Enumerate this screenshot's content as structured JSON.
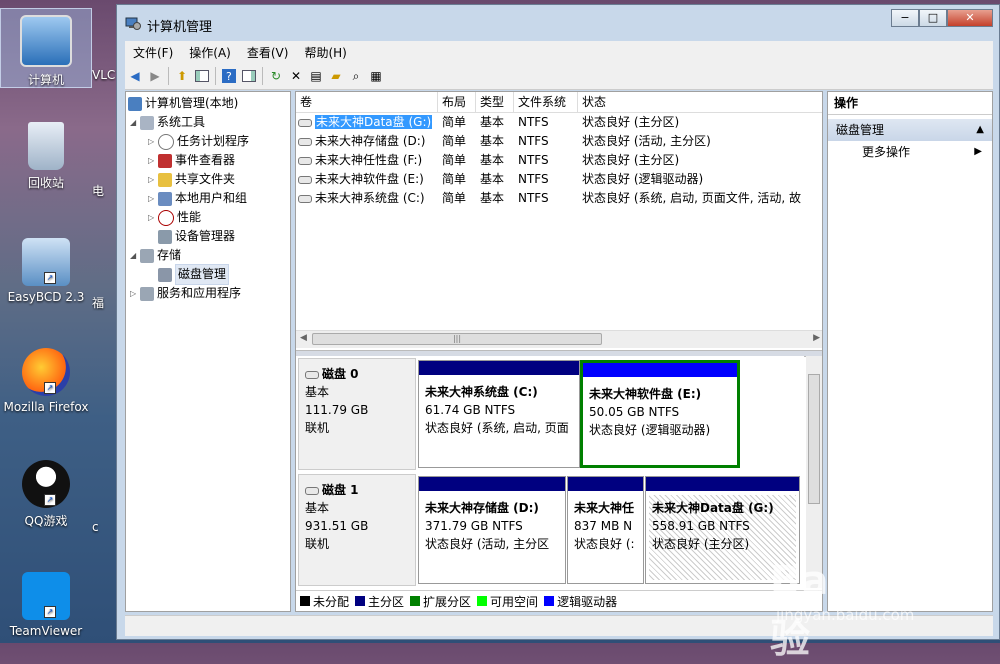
{
  "desktop": {
    "icons": [
      {
        "label": "计算机"
      },
      {
        "label": "回收站"
      },
      {
        "label": "EasyBCD 2.3"
      },
      {
        "label": "Mozilla Firefox"
      },
      {
        "label": "QQ游戏"
      },
      {
        "label": "TeamViewer"
      }
    ],
    "partial_labels": [
      "VLC",
      "电",
      "福",
      "c"
    ]
  },
  "window": {
    "title": "计算机管理",
    "controls": {
      "minimize": "−",
      "maximize": "□",
      "close": "✕"
    }
  },
  "menubar": [
    "文件(F)",
    "操作(A)",
    "查看(V)",
    "帮助(H)"
  ],
  "toolbar": [
    "back-icon",
    "forward-icon",
    "up-folder-icon",
    "show-hide-tree-icon",
    "help-icon",
    "action-pane-icon",
    "refresh-icon",
    "delete-icon",
    "properties-icon",
    "open-icon",
    "search-icon",
    "export-icon"
  ],
  "tree": {
    "root": "计算机管理(本地)",
    "items": [
      {
        "label": "系统工具",
        "level": 1,
        "expanded": true
      },
      {
        "label": "任务计划程序",
        "level": 2
      },
      {
        "label": "事件查看器",
        "level": 2
      },
      {
        "label": "共享文件夹",
        "level": 2
      },
      {
        "label": "本地用户和组",
        "level": 2
      },
      {
        "label": "性能",
        "level": 2
      },
      {
        "label": "设备管理器",
        "level": 2
      },
      {
        "label": "存储",
        "level": 1,
        "expanded": true
      },
      {
        "label": "磁盘管理",
        "level": 2,
        "selected": true
      },
      {
        "label": "服务和应用程序",
        "level": 1
      }
    ]
  },
  "volume_list": {
    "columns": [
      "卷",
      "布局",
      "类型",
      "文件系统",
      "状态"
    ],
    "rows": [
      {
        "name": "未来大神Data盘 (G:)",
        "layout": "简单",
        "type": "基本",
        "fs": "NTFS",
        "status": "状态良好 (主分区)",
        "selected": true
      },
      {
        "name": "未来大神存储盘 (D:)",
        "layout": "简单",
        "type": "基本",
        "fs": "NTFS",
        "status": "状态良好 (活动, 主分区)"
      },
      {
        "name": "未来大神任性盘 (F:)",
        "layout": "简单",
        "type": "基本",
        "fs": "NTFS",
        "status": "状态良好 (主分区)"
      },
      {
        "name": "未来大神软件盘 (E:)",
        "layout": "简单",
        "type": "基本",
        "fs": "NTFS",
        "status": "状态良好 (逻辑驱动器)"
      },
      {
        "name": "未来大神系统盘 (C:)",
        "layout": "简单",
        "type": "基本",
        "fs": "NTFS",
        "status": "状态良好 (系统, 启动, 页面文件, 活动, 故"
      }
    ],
    "scroll_thumb": "|||"
  },
  "disks": [
    {
      "name": "磁盘 0",
      "type": "基本",
      "size": "111.79 GB",
      "state": "联机",
      "partitions": [
        {
          "name": "未来大神系统盘 (C:)",
          "size": "61.74 GB NTFS",
          "status": "状态良好 (系统, 启动, 页面",
          "kind": "primary"
        },
        {
          "name": "未来大神软件盘 (E:)",
          "size": "50.05 GB NTFS",
          "status": "状态良好 (逻辑驱动器)",
          "kind": "logical"
        }
      ]
    },
    {
      "name": "磁盘 1",
      "type": "基本",
      "size": "931.51 GB",
      "state": "联机",
      "partitions": [
        {
          "name": "未来大神存储盘 (D:)",
          "size": "371.79 GB NTFS",
          "status": "状态良好 (活动, 主分区",
          "kind": "primary"
        },
        {
          "name": "未来大神任",
          "size": "837 MB N",
          "status": "状态良好 (:",
          "kind": "primary"
        },
        {
          "name": "未来大神Data盘 (G:)",
          "size": "558.91 GB NTFS",
          "status": "状态良好 (主分区)",
          "kind": "primary",
          "selected": true
        }
      ]
    }
  ],
  "legend": [
    {
      "label": "未分配",
      "color": "#000000"
    },
    {
      "label": "主分区",
      "color": "#000080"
    },
    {
      "label": "扩展分区",
      "color": "#008000"
    },
    {
      "label": "可用空间",
      "color": "#00ff00"
    },
    {
      "label": "逻辑驱动器",
      "color": "#0000ff"
    }
  ],
  "actions": {
    "header": "操作",
    "section": "磁盘管理",
    "items": [
      "更多操作"
    ]
  },
  "watermark": {
    "main": "Bai du 经验",
    "sub": "jingyan.baidu.com"
  }
}
